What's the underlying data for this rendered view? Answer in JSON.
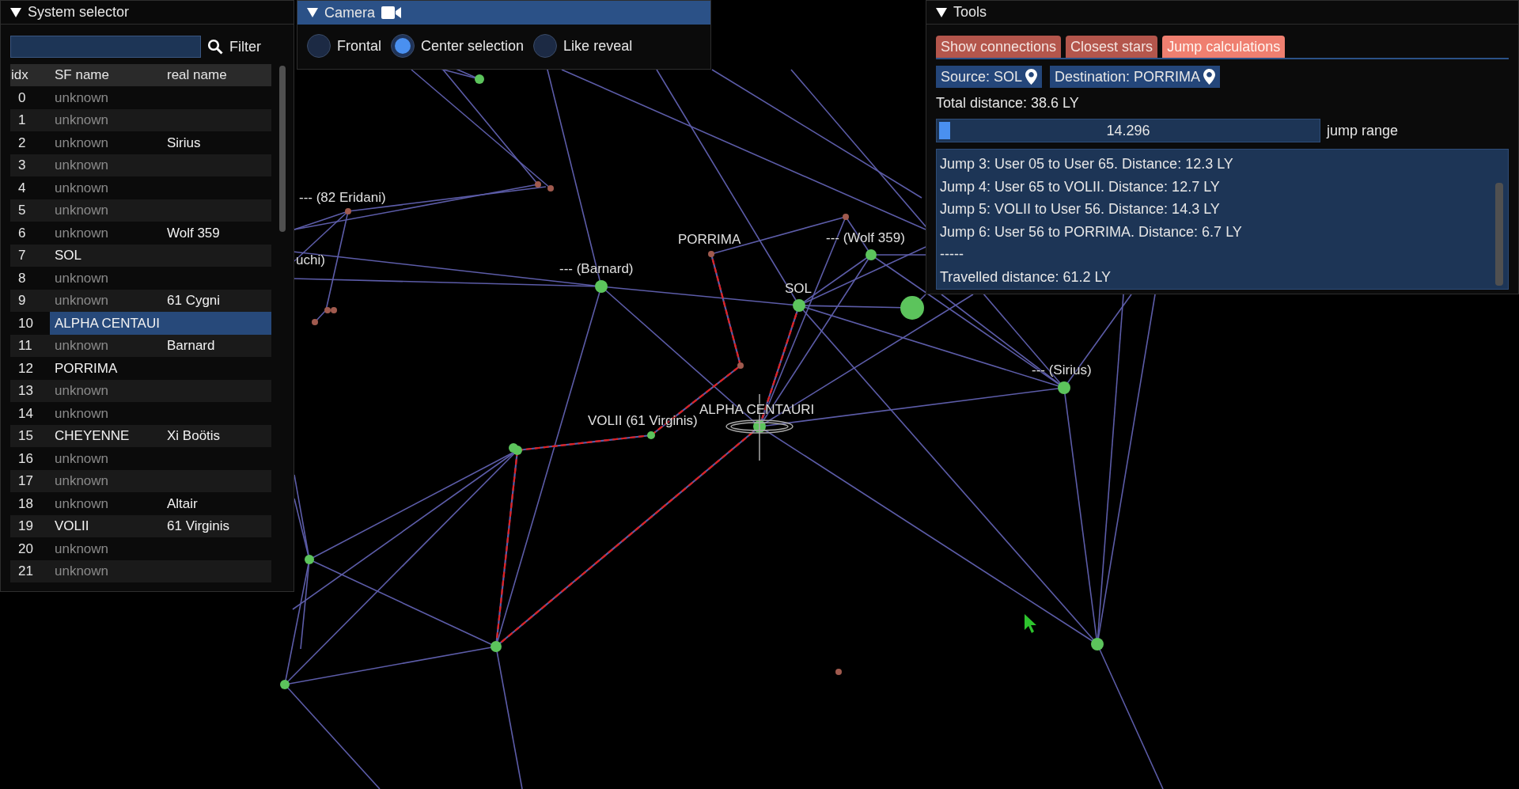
{
  "star_map": {
    "labels": [
      "--- (82 Eridani)",
      "uchi)",
      "PORRIMA",
      "--- (Barnard)",
      "--- (Wolf 359)",
      "SOL",
      "--- (Sirius)",
      "ALPHA CENTAURI",
      "VOLII (61 Virginis)"
    ]
  },
  "system_selector": {
    "title": "System selector",
    "filter": {
      "label": "Filter"
    },
    "columns": [
      "idx",
      "SF name",
      "real name"
    ],
    "rows": [
      {
        "idx": "0",
        "sf_name": "unknown",
        "named": false,
        "selected": false
      },
      {
        "idx": "1",
        "sf_name": "unknown",
        "named": false,
        "selected": false
      },
      {
        "idx": "2",
        "sf_name": "unknown",
        "named": false,
        "real_name": "Sirius",
        "selected": false
      },
      {
        "idx": "3",
        "sf_name": "unknown",
        "named": false,
        "selected": false
      },
      {
        "idx": "4",
        "sf_name": "unknown",
        "named": false,
        "selected": false
      },
      {
        "idx": "5",
        "sf_name": "unknown",
        "named": false,
        "selected": false
      },
      {
        "idx": "6",
        "sf_name": "unknown",
        "named": false,
        "real_name": "Wolf 359",
        "selected": false
      },
      {
        "idx": "7",
        "sf_name": "SOL",
        "named": true,
        "selected": false
      },
      {
        "idx": "8",
        "sf_name": "unknown",
        "named": false,
        "selected": false
      },
      {
        "idx": "9",
        "sf_name": "unknown",
        "named": false,
        "real_name": "61 Cygni",
        "selected": false
      },
      {
        "idx": "10",
        "sf_name": "ALPHA CENTAUI",
        "named": true,
        "selected": true
      },
      {
        "idx": "11",
        "sf_name": "unknown",
        "named": false,
        "real_name": "Barnard",
        "selected": false
      },
      {
        "idx": "12",
        "sf_name": "PORRIMA",
        "named": true,
        "selected": false
      },
      {
        "idx": "13",
        "sf_name": "unknown",
        "named": false,
        "selected": false
      },
      {
        "idx": "14",
        "sf_name": "unknown",
        "named": false,
        "selected": false
      },
      {
        "idx": "15",
        "sf_name": "CHEYENNE",
        "named": true,
        "real_name": "Xi Boötis",
        "selected": false
      },
      {
        "idx": "16",
        "sf_name": "unknown",
        "named": false,
        "selected": false
      },
      {
        "idx": "17",
        "sf_name": "unknown",
        "named": false,
        "selected": false
      },
      {
        "idx": "18",
        "sf_name": "unknown",
        "named": false,
        "real_name": "Altair",
        "selected": false
      },
      {
        "idx": "19",
        "sf_name": "VOLII",
        "named": true,
        "real_name": "61 Virginis",
        "selected": false
      },
      {
        "idx": "20",
        "sf_name": "unknown",
        "named": false,
        "selected": false
      },
      {
        "idx": "21",
        "sf_name": "unknown",
        "named": false,
        "selected": false
      }
    ]
  },
  "camera": {
    "title": "Camera",
    "options": [
      {
        "label": "Frontal",
        "selected": false
      },
      {
        "label": "Center selection",
        "selected": true
      },
      {
        "label": "Like reveal",
        "selected": false
      }
    ]
  },
  "tools": {
    "title": "Tools",
    "tabs": [
      {
        "label": "Show connections",
        "selected": false
      },
      {
        "label": "Closest stars",
        "selected": false
      },
      {
        "label": "Jump calculations",
        "selected": true
      }
    ],
    "source": "Source: SOL",
    "destination": "Destination: PORRIMA",
    "total_distance": "Total distance: 38.6 LY",
    "jump_range": {
      "value": "14.296",
      "label": "jump range",
      "level": 0
    },
    "log": [
      "Jump 3: User 05 to User 65. Distance: 12.3 LY",
      "Jump 4: User 65 to VOLII. Distance: 12.7 LY",
      "Jump 5: VOLII to User 56. Distance: 14.3 LY",
      "Jump 6: User 56 to PORRIMA. Distance: 6.7 LY",
      "-----",
      "Travelled distance: 61.2 LY"
    ]
  }
}
